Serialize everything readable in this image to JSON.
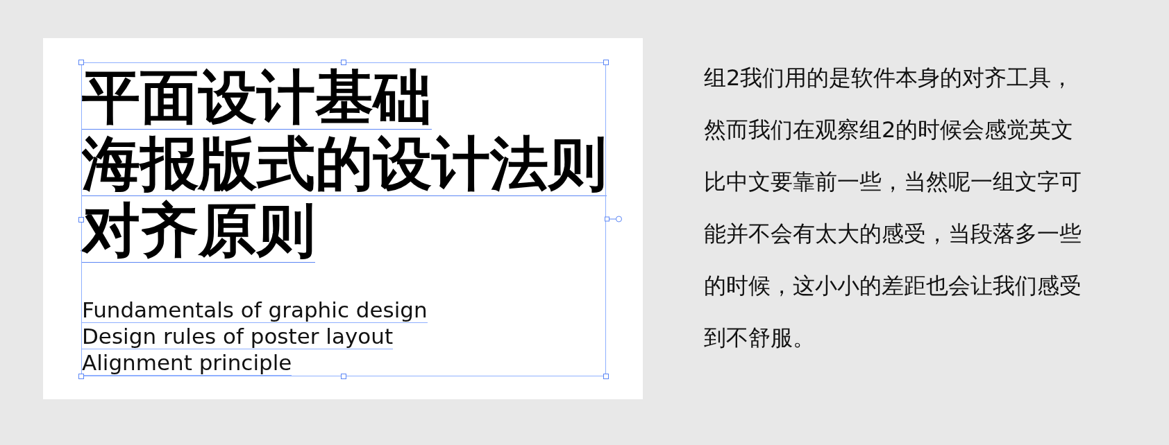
{
  "headline": [
    "平面设计基础",
    "海报版式的设计法则",
    "对齐原则"
  ],
  "subtitle": [
    "Fundamentals of graphic design",
    "Design rules of poster layout",
    "Alignment principle"
  ],
  "paragraph": [
    "组2我们用的是软件本身的对齐工具，",
    "然而我们在观察组2的时候会感觉英文",
    "比中文要靠前一些，当然呢一组文字可",
    "能并不会有太大的感受，当段落多一些",
    "的时候，这小小的差距也会让我们感受",
    "到不舒服。"
  ]
}
